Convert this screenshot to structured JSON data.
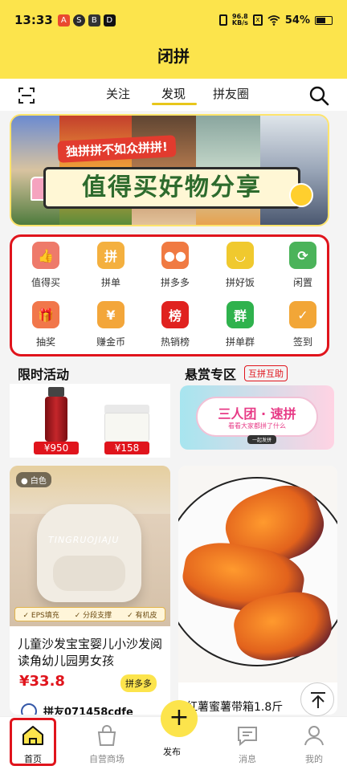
{
  "status_bar": {
    "time": "13:33",
    "app_icons": [
      "A",
      "S",
      "B",
      "D"
    ],
    "network_speed": "96.8",
    "network_unit": "KB/s",
    "battery": "54%"
  },
  "header": {
    "title": "闭拼"
  },
  "tabs": {
    "items": [
      "关注",
      "发现",
      "拼友圈"
    ],
    "active": "发现"
  },
  "banner": {
    "ribbon": "独拼拼不如众拼拼!",
    "headline": "值得买好物分享"
  },
  "quick_grid": {
    "items": [
      {
        "label": "值得买",
        "icon": "thumbs-up-icon",
        "color": "#ee7a6a",
        "glyph": "👍"
      },
      {
        "label": "拼单",
        "icon": "pin-coin-icon",
        "color": "#f4b03f",
        "glyph": "拼"
      },
      {
        "label": "拼多多",
        "icon": "group-people-icon",
        "color": "#f07a42",
        "glyph": "●●"
      },
      {
        "label": "拼好饭",
        "icon": "smile-bowl-icon",
        "color": "#f0c92e",
        "glyph": "◡"
      },
      {
        "label": "闲置",
        "icon": "cart-recycle-icon",
        "color": "#4bb35a",
        "glyph": "⟳"
      },
      {
        "label": "抽奖",
        "icon": "gift-icon",
        "color": "#f1774b",
        "glyph": "🎁"
      },
      {
        "label": "赚金币",
        "icon": "coin-hand-icon",
        "color": "#f3a63a",
        "glyph": "¥"
      },
      {
        "label": "热销榜",
        "icon": "ranking-icon",
        "color": "#e0221f",
        "glyph": "榜"
      },
      {
        "label": "拼单群",
        "icon": "group-chat-icon",
        "color": "#2fb24d",
        "glyph": "群"
      },
      {
        "label": "签到",
        "icon": "calendar-check-icon",
        "color": "#f2a637",
        "glyph": "✓"
      }
    ]
  },
  "sections": {
    "limited": {
      "title": "限时活动",
      "prices": [
        "¥950",
        "¥158"
      ]
    },
    "bounty": {
      "title": "悬赏专区",
      "badge": "互拼互助",
      "banner_title": "三人团 · 速拼",
      "banner_sub": "看看大家都拼了什么",
      "banner_btn": "一起发拼"
    }
  },
  "feed": [
    {
      "badge": "白色",
      "watermark": "TINGRUOJIAJU",
      "features": [
        "EPS填充",
        "分段支撑",
        "有机皮"
      ],
      "title": "儿童沙发宝宝婴儿小沙发阅读角幼儿园男女孩",
      "price": "¥33.8",
      "tag": "拼多多",
      "user": "拼友071458cdfe"
    },
    {
      "title": "红薯蜜薯带箱1.8斤"
    }
  ],
  "bottom_nav": {
    "items": [
      {
        "label": "首页",
        "icon": "home-icon"
      },
      {
        "label": "自营商场",
        "icon": "shopping-bag-icon"
      },
      {
        "label": "发布",
        "icon": "plus-icon"
      },
      {
        "label": "消息",
        "icon": "message-icon"
      },
      {
        "label": "我的",
        "icon": "person-icon"
      }
    ]
  },
  "colors": {
    "accent": "#fce44c",
    "highlight": "#e0141c"
  }
}
